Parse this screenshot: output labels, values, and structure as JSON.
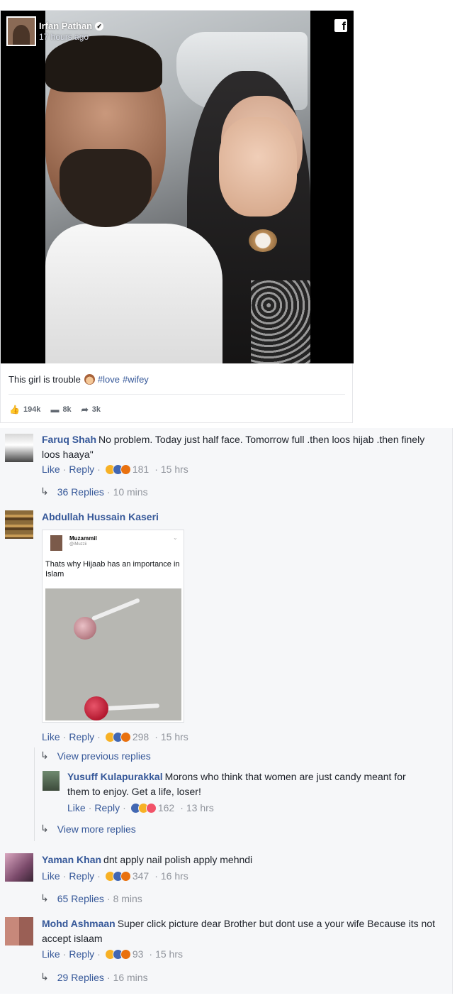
{
  "post": {
    "author": "Irfan Pathan",
    "verified_mark": "✓",
    "time": "17 hours ago",
    "fb_logo": "f",
    "caption_text": "This girl is trouble",
    "hashtags": [
      "#love",
      "#wifey"
    ],
    "stats": {
      "likes": "194k",
      "comments": "8k",
      "shares": "3k",
      "like_icon": "👍",
      "comment_icon": "▬",
      "share_icon": "➦"
    }
  },
  "comments": [
    {
      "name": "Faruq Shah",
      "text": "No problem. Today just half face. Tomorrow full .then loos hijab .then finely loos haaya\"",
      "like": "Like",
      "reply": "Reply",
      "reaction_count": "181",
      "time": "15 hrs",
      "replies_label": "36 Replies",
      "replies_time": "10 mins"
    },
    {
      "name": "Abdullah Hussain Kaseri",
      "embed": {
        "name": "Muzammil",
        "handle": "@iMuzzii",
        "chevron": "⌄",
        "text": "Thats why Hijaab has an importance in Islam"
      },
      "like": "Like",
      "reply": "Reply",
      "reaction_count": "298",
      "time": "15 hrs",
      "view_previous": "View previous replies",
      "view_more": "View more replies"
    },
    {
      "name": "Yusuff Kulapurakkal",
      "text": "Morons who think that women are just candy meant for them to enjoy. Get a life, loser!",
      "like": "Like",
      "reply": "Reply",
      "reaction_count": "162",
      "time": "13 hrs"
    },
    {
      "name": "Yaman Khan",
      "text": "dnt apply nail polish apply mehndi",
      "like": "Like",
      "reply": "Reply",
      "reaction_count": "347",
      "time": "16 hrs",
      "replies_label": "65 Replies",
      "replies_time": "8 mins"
    },
    {
      "name": "Mohd Ashmaan",
      "text": "Super click picture dear Brother but dont use a your wife Because its not accept islaam",
      "like": "Like",
      "reply": "Reply",
      "reaction_count": "93",
      "time": "15 hrs",
      "replies_label": "29 Replies",
      "replies_time": "16 mins"
    }
  ],
  "ui": {
    "sep": "·",
    "reply_arrow": "↳"
  },
  "colors": {
    "link": "#365899",
    "meta": "#90949c",
    "comments_bg": "#f6f7f9"
  }
}
